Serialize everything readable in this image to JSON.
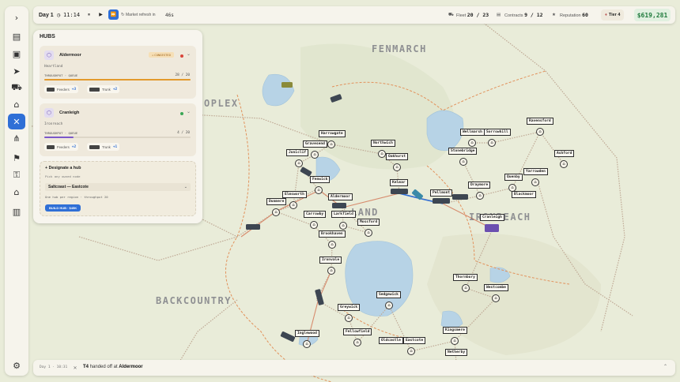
{
  "topbar": {
    "day": "Day 1",
    "time": "11:14",
    "speed_pause": "⏸",
    "speed_play": "▶",
    "speed_fast": "⏩",
    "market_text": "Market refresh in",
    "market_age": "46s",
    "fleet_label": "Fleet",
    "fleet_value": "20 / 23",
    "contracts_label": "Contracts",
    "contracts_value": "9 / 12",
    "reputation_label": "Reputation",
    "reputation_value": "60",
    "tier": "Tier 4",
    "money": "$619,281"
  },
  "rail": {
    "expand": "›",
    "items": [
      "▤",
      "▣",
      "➤",
      "⛟",
      "⌂",
      "✕",
      "⋔",
      "⚑",
      "⚿",
      "⌂",
      "▥"
    ],
    "settings": "⚙"
  },
  "panel": {
    "title": "HUBS",
    "hubs": [
      {
        "name": "Aldermoor",
        "badge": "CONGESTED",
        "badge_icon": "⚠",
        "status_color": "#d9453b",
        "region": "Heartland",
        "tq": "THROUGHPUT · QUEUE",
        "ratio": "28 / 20",
        "fill": 1.0,
        "bar_color": "#e39a2d",
        "feeders_label": "Feeders",
        "feeders": "+3",
        "trunk_label": "Trunk",
        "trunk": "+2"
      },
      {
        "name": "Cranleigh",
        "badge": "",
        "status_color": "#3aa655",
        "region": "Ironreach",
        "tq": "THROUGHPUT · QUEUE",
        "ratio": "4 / 20",
        "fill": 0.2,
        "bar_color": "#7b58c9",
        "feeders_label": "Feeders",
        "feeders": "+2",
        "trunk_label": "Trunk",
        "trunk": "+1"
      }
    ],
    "designate": {
      "title": "+ Designate a hub",
      "hint": "Pick any owned node",
      "selected": "Saltcoast — Eastcote",
      "rule": "One hub per region · throughput 20",
      "button": "BUILD HUB · $45K"
    }
  },
  "log": {
    "time": "Day 1 · 10:31",
    "icon": "✕",
    "actor": "T4",
    "text": "handed off at",
    "place": "Aldermoor",
    "chevron": "⌃"
  },
  "map": {
    "regions": [
      "FENMARCH",
      "OPLEX",
      "LAND",
      "IRONREACH",
      "BACKCOUNTRY"
    ],
    "cities": [
      "Harrowgate",
      "Gravesend",
      "Juniclif",
      "Northwich",
      "Oakhurst",
      "Fenwick",
      "Elmsworth",
      "Aldermoor",
      "Dunmere",
      "Carrowby",
      "Larkfield",
      "Mossford",
      "Brookhaven",
      "Kelmar",
      "Pellmont",
      "Wellmarsh",
      "Sorrowhill",
      "Stonebridge",
      "Ravensford",
      "Ashford",
      "Quenby",
      "Yarrowden",
      "Draymore",
      "Blackmoor",
      "Cranleigh",
      "Ironvale",
      "Thornbury",
      "Westcombe",
      "Sedgewick",
      "Greywick",
      "Kingsmere",
      "Fellowfield",
      "Oldcastle",
      "Eastcote",
      "Inglewood",
      "Netherby"
    ],
    "colors": {
      "land": "#e9ecd9",
      "water": "#b7d3e6",
      "road": "#c9b9a6",
      "rail": "#d78b6d",
      "accent": "#2f6fd6"
    }
  }
}
